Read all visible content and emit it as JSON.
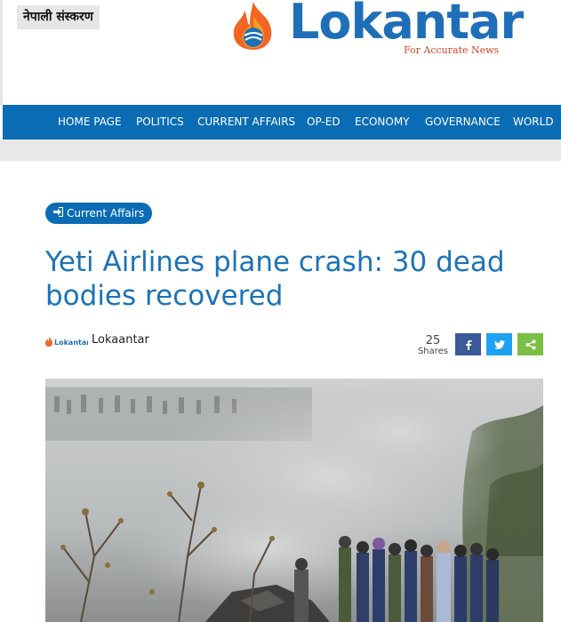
{
  "header": {
    "language_toggle": "नेपाली संस्करण",
    "logo_text": "Lokantar",
    "logo_tagline": "For Accurate News"
  },
  "nav": {
    "items": [
      "HOME PAGE",
      "POLITICS",
      "CURRENT AFFAIRS",
      "OP-ED",
      "ECONOMY",
      "GOVERNANCE",
      "WORLD"
    ]
  },
  "article": {
    "category": "Current Affairs",
    "title": "Yeti Airlines plane crash: 30 dead bodies recovered",
    "author": "Lokaantar",
    "author_logo_text": "Lokantar",
    "shares_count": "25",
    "shares_label": "Shares"
  },
  "colors": {
    "brand_blue": "#0a6cb4",
    "title_blue": "#1b73b6",
    "logo_orange": "#f26522",
    "facebook": "#3b5998",
    "twitter": "#1da1f2",
    "share": "#7bc043"
  },
  "icons": {
    "category": "sign-in-icon",
    "facebook": "facebook-icon",
    "twitter": "twitter-icon",
    "share": "share-icon"
  }
}
